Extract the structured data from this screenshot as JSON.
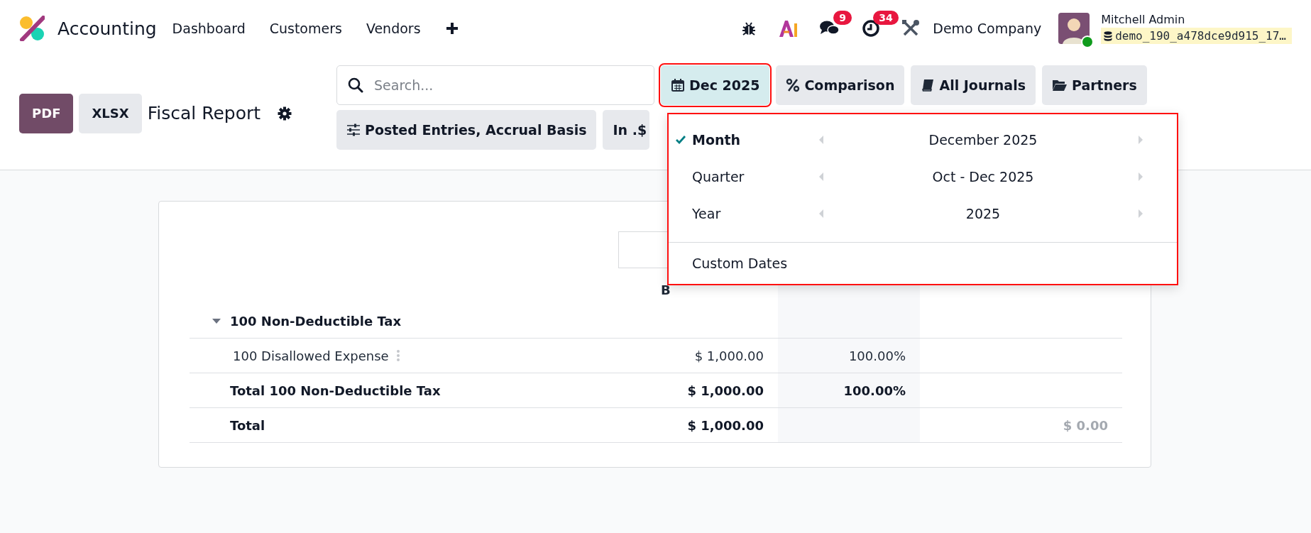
{
  "navbar": {
    "app_name": "Accounting",
    "menu": [
      "Dashboard",
      "Customers",
      "Vendors"
    ],
    "messages_badge": "9",
    "activities_badge": "34",
    "company": "Demo Company",
    "user": {
      "name": "Mitchell Admin",
      "database": "demo_190_a478dce9d915_17…",
      "online": true
    }
  },
  "control_panel": {
    "buttons": [
      {
        "label": "PDF",
        "primary": true
      },
      {
        "label": "XLSX",
        "primary": false
      }
    ],
    "title": "Fiscal Report",
    "search": {
      "placeholder": "Search..."
    },
    "filters": [
      {
        "label": "Dec 2025",
        "selected": true,
        "highlighted": true
      },
      {
        "label": "Comparison",
        "selected": false,
        "highlighted": false
      },
      {
        "label": "All Journals",
        "selected": false,
        "highlighted": false
      },
      {
        "label": "Partners",
        "selected": false,
        "highlighted": false
      },
      {
        "label": "Posted Entries, Accrual Basis",
        "selected": false,
        "highlighted": false
      },
      {
        "label": "In .$",
        "selected": false,
        "highlighted": false
      }
    ]
  },
  "date_menu": {
    "highlighted": true,
    "periods": [
      {
        "label": "Month",
        "value": "December 2025",
        "selected": true
      },
      {
        "label": "Quarter",
        "value": "Oct - Dec 2025",
        "selected": false
      },
      {
        "label": "Year",
        "value": "2025",
        "selected": false
      }
    ],
    "custom": "Custom Dates"
  },
  "report": {
    "column_header": "B",
    "rows": [
      {
        "kind": "section",
        "label": "100 Non-Deductible Tax",
        "expanded": true
      },
      {
        "kind": "line",
        "label": "100 Disallowed Expense",
        "amount": "$ 1,000.00",
        "percent": "100.00%"
      },
      {
        "kind": "total",
        "label": "Total 100 Non-Deductible Tax",
        "amount": "$ 1,000.00",
        "percent": "100.00%"
      },
      {
        "kind": "total",
        "label": "Total",
        "amount": "$ 1,000.00",
        "column_4": "$ 0.00"
      }
    ]
  }
}
